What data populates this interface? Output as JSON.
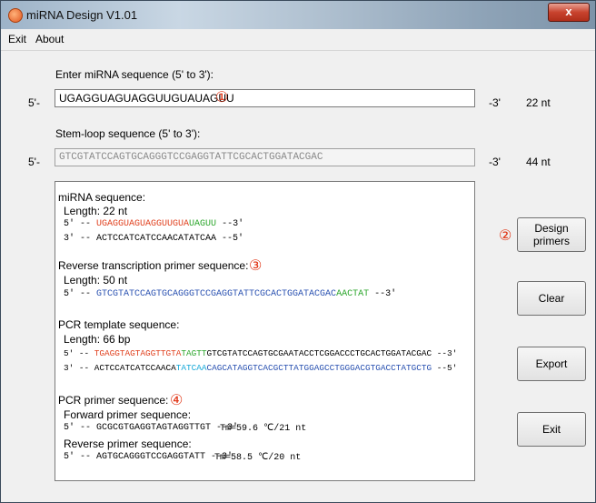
{
  "window": {
    "title": "miRNA Design V1.01",
    "close_glyph": "x"
  },
  "menu": {
    "items": [
      "Exit",
      "About"
    ]
  },
  "mirna_input": {
    "label": "Enter miRNA sequence (5' to 3'):",
    "prefix": "5'-",
    "value": "UGAGGUAGUAGGUUGUAUAGUU",
    "suffix": "-3'",
    "length": "22 nt",
    "marker": "①"
  },
  "stemloop_input": {
    "label": "Stem-loop sequence (5' to 3'):",
    "prefix": "5'-",
    "value": "GTCGTATCCAGTGCAGGGTCCGAGGTATTCGCACTGGATACGAC",
    "suffix": "-3'",
    "length": "44 nt"
  },
  "results": {
    "mirna": {
      "heading": "miRNA sequence:",
      "length": "Length: 22 nt",
      "line1_prefix": "5' -- ",
      "line1_red": "UGAGGUAGUAGGUUGUA",
      "line1_green": "UAGUU",
      "line1_suffix": " --3'",
      "line2": "3' -- ACTCCATCATCCAACATATCAA --5'"
    },
    "rt_primer": {
      "heading": "Reverse transcription primer sequence:",
      "marker": "③",
      "length": "Length: 50 nt",
      "prefix": "5' -- ",
      "blue": "GTCGTATCCAGTGCAGGGTCCGAGGTATTCGCACTGGATACGAC",
      "green": "AACTAT",
      "suffix": " --3'"
    },
    "pcr_template": {
      "heading": "PCR template sequence:",
      "length": "Length: 66 bp",
      "line1_prefix": "5' -- ",
      "line1_red": "TGAGGTAGTAGGTTGTA",
      "line1_green": "TAGTT",
      "line1_black": "GTCGTATCCAGTGCGAATACCTCGGACCCTGCACTGGATACGAC",
      "line1_suffix": " --3'",
      "line2_prefix": "3' -- ",
      "line2_black": "ACTCCATCATCCAACA",
      "line2_sky": "TATCAA",
      "line2_blue": "CAGCATAGGTCACGCTTATGGAGCCTGGGACGTGACCTATGCTG",
      "line2_suffix": " --5'"
    },
    "pcr_primer": {
      "heading": "PCR primer sequence:",
      "marker": "④",
      "forward_label": "Forward primer sequence:",
      "forward": "5' -- GCGCGTGAGGTAGTAGGTTGT --3'",
      "forward_tm": "Tm=59.6 ℃/21 nt",
      "reverse_label": "Reverse primer sequence:",
      "reverse": "5' -- AGTGCAGGGTCCGAGGTATT --3'",
      "reverse_tm": "Tm=58.5 ℃/20 nt"
    }
  },
  "buttons": {
    "design_marker": "②",
    "design_line1": "Design",
    "design_line2": "primers",
    "clear": "Clear",
    "export": "Export",
    "exit": "Exit"
  }
}
